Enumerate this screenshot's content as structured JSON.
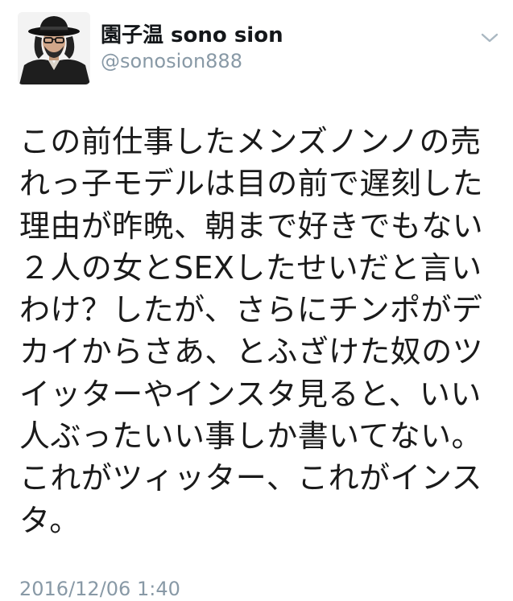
{
  "tweet": {
    "author": {
      "display_name": "園子温 sono sion",
      "handle": "@sonosion888"
    },
    "menu_icon": "chevron-down-icon",
    "body_text": "この前仕事したメンズノンノの売\nれっ子モデルは目の前で遅刻した\n理由が昨晩、朝まで好きでもない\n２人の女とSEXしたせいだと言い\nわけ？したが、さらにチンポがデ\nカイからさあ、とふざけた奴のツ\nイッターやインスタ見ると、いい\n人ぶったいい事しか書いてない。\nこれがツィッター、これがインス\nタ。",
    "timestamp": "2016/12/06 1:40",
    "colors": {
      "text": "#14171a",
      "secondary": "#8899a6",
      "background": "#ffffff"
    }
  }
}
